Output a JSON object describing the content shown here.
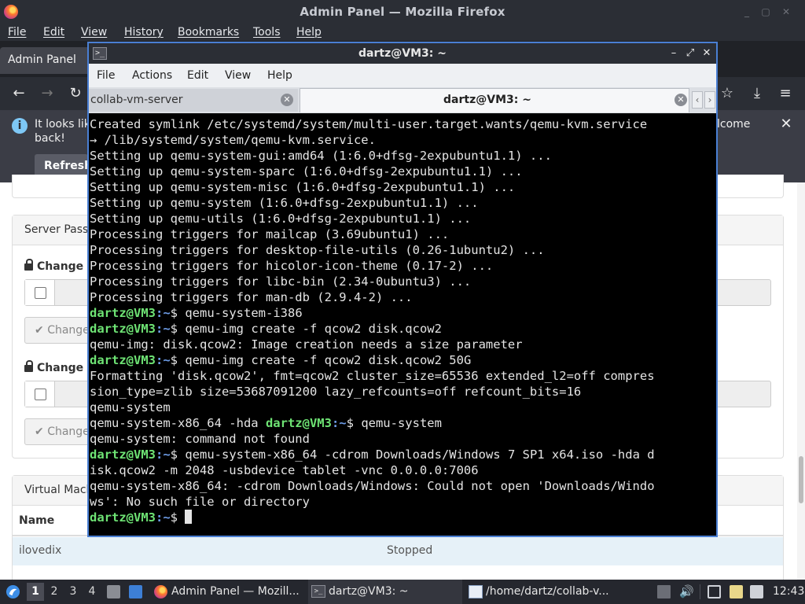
{
  "firefox": {
    "window_title": "Admin Panel — Mozilla Firefox",
    "menu": [
      "File",
      "Edit",
      "View",
      "History",
      "Bookmarks",
      "Tools",
      "Help"
    ],
    "tab_title": "Admin Panel",
    "notification": {
      "text_line1": "It looks lik",
      "text_line2": "back!",
      "text_right": "lcome",
      "refresh_label": "Refresh"
    },
    "page": {
      "panel_server_password": "Server Passw",
      "change_label_1": "Change M",
      "change_button_1": "Change",
      "change_label_2": "Change M",
      "change_button_2": "Change",
      "panel_virtual_machines": "Virtual Mach",
      "table_header_name": "Name",
      "vm_rows": [
        {
          "name": "ilovedix",
          "status": "Stopped"
        }
      ]
    }
  },
  "terminal": {
    "window_title": "dartz@VM3: ~",
    "menu": [
      "File",
      "Actions",
      "Edit",
      "View",
      "Help"
    ],
    "tabs": [
      {
        "label": "collab-vm-server"
      },
      {
        "label": "dartz@VM3: ~"
      }
    ],
    "prompt": {
      "user": "dartz@VM3",
      "path": ":~",
      "symbol": "$ "
    },
    "lines": [
      {
        "text": "Created symlink /etc/systemd/system/multi-user.target.wants/qemu-kvm.service"
      },
      {
        "text": "→ /lib/systemd/system/qemu-kvm.service."
      },
      {
        "text": "Setting up qemu-system-gui:amd64 (1:6.0+dfsg-2expubuntu1.1) ..."
      },
      {
        "text": "Setting up qemu-system-sparc (1:6.0+dfsg-2expubuntu1.1) ..."
      },
      {
        "text": "Setting up qemu-system-misc (1:6.0+dfsg-2expubuntu1.1) ..."
      },
      {
        "text": "Setting up qemu-system (1:6.0+dfsg-2expubuntu1.1) ..."
      },
      {
        "text": "Setting up qemu-utils (1:6.0+dfsg-2expubuntu1.1) ..."
      },
      {
        "text": "Processing triggers for mailcap (3.69ubuntu1) ..."
      },
      {
        "text": "Processing triggers for desktop-file-utils (0.26-1ubuntu2) ..."
      },
      {
        "text": "Processing triggers for hicolor-icon-theme (0.17-2) ..."
      },
      {
        "text": "Processing triggers for libc-bin (2.34-0ubuntu3) ..."
      },
      {
        "text": "Processing triggers for man-db (2.9.4-2) ..."
      },
      {
        "prompt": true,
        "text": "qemu-system-i386"
      },
      {
        "prompt": true,
        "text": "qemu-img create -f qcow2 disk.qcow2"
      },
      {
        "text": "qemu-img: disk.qcow2: Image creation needs a size parameter"
      },
      {
        "prompt": true,
        "text": "qemu-img create -f qcow2 disk.qcow2 50G"
      },
      {
        "text": "Formatting 'disk.qcow2', fmt=qcow2 cluster_size=65536 extended_l2=off compres"
      },
      {
        "text": "sion_type=zlib size=53687091200 lazy_refcounts=off refcount_bits=16"
      },
      {
        "text": "qemu-system"
      },
      {
        "text": "qemu-system-x86_64 -hda ",
        "prompt_after": true,
        "after_text": "qemu-system"
      },
      {
        "text": "qemu-system: command not found"
      },
      {
        "prompt": true,
        "text": "qemu-system-x86_64 -cdrom Downloads/Windows 7 SP1 x64.iso -hda d"
      },
      {
        "text": "isk.qcow2 -m 2048 -usbdevice tablet -vnc 0.0.0.0:7006"
      },
      {
        "text": "qemu-system-x86_64: -cdrom Downloads/Windows: Could not open 'Downloads/Windo"
      },
      {
        "text": "ws': No such file or directory"
      },
      {
        "prompt": true,
        "text": "",
        "cursor": true
      }
    ]
  },
  "taskbar": {
    "workspaces": [
      "1",
      "2",
      "3",
      "4"
    ],
    "active_workspace": "1",
    "tasks": [
      {
        "label": "Admin Panel — Mozill...",
        "icon": "firefox-icon"
      },
      {
        "label": "dartz@VM3: ~",
        "icon": "terminal-icon"
      },
      {
        "label": "/home/dartz/collab-v...",
        "icon": "text-editor-icon"
      }
    ],
    "clock": "12:43"
  },
  "colors": {
    "prompt_user": "#6ee374",
    "prompt_path": "#6e9de8",
    "terminal_bg": "#000000",
    "terminal_border": "#4a7fd3"
  }
}
